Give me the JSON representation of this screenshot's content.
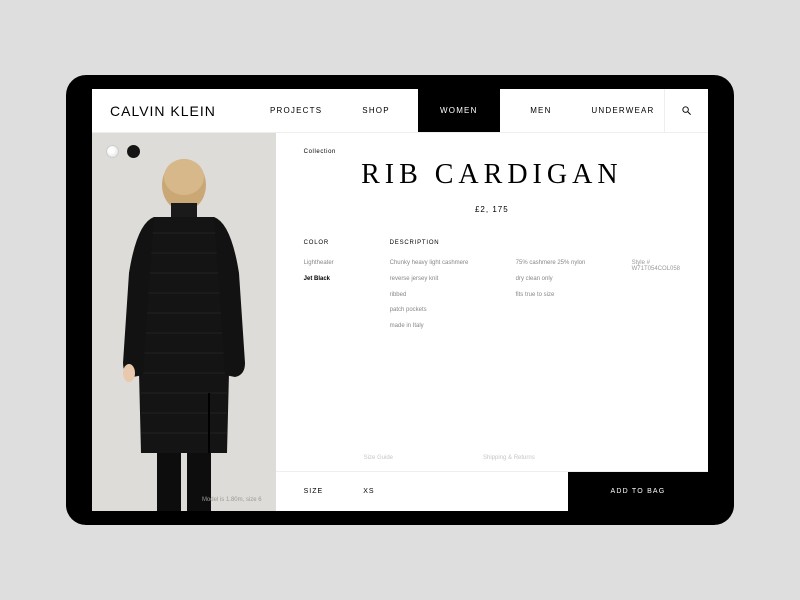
{
  "brand": "CALVIN KLEIN",
  "nav": {
    "primary": [
      "PROJECTS",
      "SHOP"
    ],
    "secondary": [
      "WOMEN",
      "MEN",
      "UNDERWEAR"
    ],
    "active": "WOMEN"
  },
  "swatches": [
    {
      "name": "Lightheater",
      "class": "light"
    },
    {
      "name": "Jet Black",
      "class": "dark"
    }
  ],
  "collection_label": "Collection",
  "product": {
    "title": "RIB CARDIGAN",
    "price": "£2, 175",
    "model_note": "Model is 1.80m, size 6"
  },
  "details": {
    "color_head": "COLOR",
    "colors": [
      "Lightheater",
      "Jet Black"
    ],
    "selected_color": "Jet Black",
    "desc_head": "DESCRIPTION",
    "desc_lines": [
      "Chunky heavy light cashmere",
      "reverse jersey knit",
      "ribbed",
      "patch pockets",
      "made in Italy"
    ],
    "care_lines": [
      "75% cashmere 25% nylon",
      "dry clean only",
      "fits true to size"
    ],
    "style_no": "Style # W71T054COL058"
  },
  "sub_links": {
    "size_guide": "Size Guide",
    "shipping": "Shipping & Returns"
  },
  "bottom": {
    "size_label": "SIZE",
    "size_value": "XS",
    "add_label": "ADD TO BAG"
  }
}
